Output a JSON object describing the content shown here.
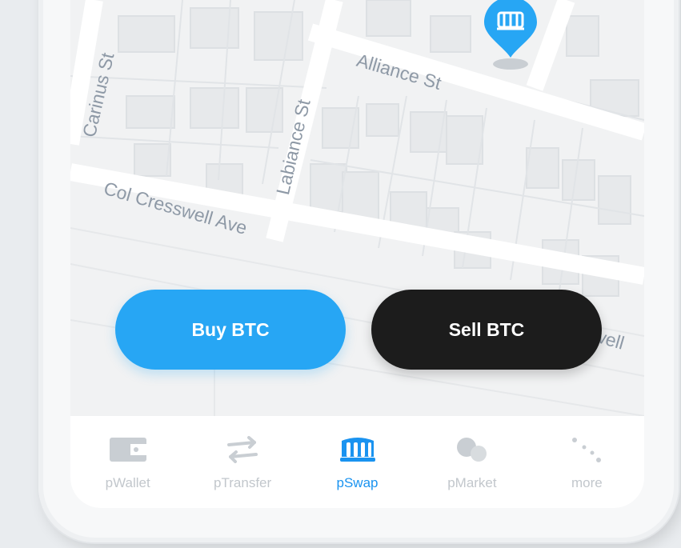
{
  "map": {
    "streets": [
      "Carinus St",
      "Labiance St",
      "Alliance St",
      "Col Cresswell Ave",
      "Col Cresswell"
    ]
  },
  "actions": {
    "buy_label": "Buy BTC",
    "sell_label": "Sell BTC"
  },
  "tabs": [
    {
      "label": "pWallet",
      "icon": "wallet-icon",
      "active": false
    },
    {
      "label": "pTransfer",
      "icon": "transfer-arrows-icon",
      "active": false
    },
    {
      "label": "pSwap",
      "icon": "storefront-icon",
      "active": true
    },
    {
      "label": "pMarket",
      "icon": "market-coins-icon",
      "active": false
    },
    {
      "label": "more",
      "icon": "more-dots-icon",
      "active": false
    }
  ],
  "colors": {
    "accent": "#27a6f4",
    "active_tab": "#1a93f0",
    "sell_button": "#1c1c1c",
    "inactive_tab": "#c2c7cc"
  }
}
